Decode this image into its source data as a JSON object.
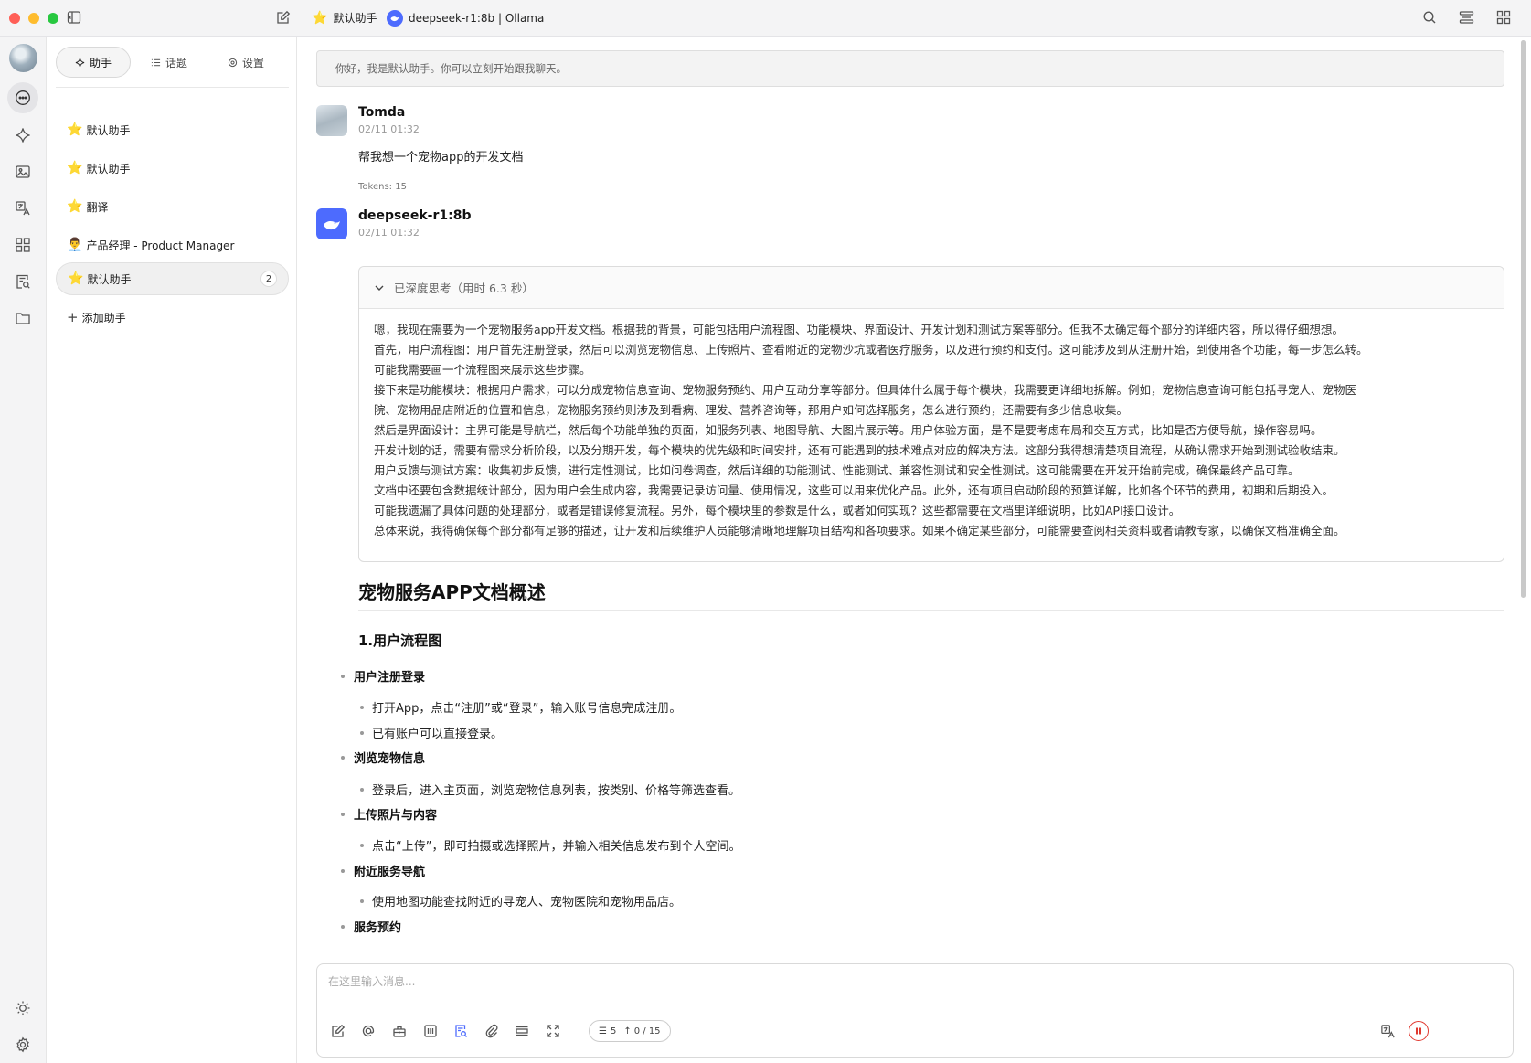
{
  "titlebar": {
    "assistant_emoji": "⭐",
    "assistant_name": "默认助手",
    "model_label": "deepseek-r1:8b | Ollama"
  },
  "sidebar": {
    "tabs": [
      {
        "label": "助手",
        "icon": "sparkle-icon"
      },
      {
        "label": "话题",
        "icon": "list-icon"
      },
      {
        "label": "设置",
        "icon": "gear-icon"
      }
    ],
    "assistants": [
      {
        "emoji": "⭐",
        "label": "默认助手"
      },
      {
        "emoji": "⭐",
        "label": "默认助手"
      },
      {
        "emoji": "⭐",
        "label": "翻译"
      },
      {
        "emoji": "👨‍💼",
        "label": "产品经理 - Product Manager"
      },
      {
        "emoji": "⭐",
        "label": "默认助手",
        "count": "2",
        "selected": true
      }
    ],
    "add_label": "添加助手"
  },
  "chat": {
    "notice": "你好，我是默认助手。你可以立刻开始跟我聊天。",
    "user_msg": {
      "name": "Tomda",
      "time": "02/11 01:32",
      "text": "帮我想一个宠物app的开发文档",
      "tokens": "Tokens: 15"
    },
    "bot_msg": {
      "name": "deepseek-r1:8b",
      "time": "02/11 01:32",
      "thinking_title": "已深度思考（用时 6.3 秒）",
      "thinking_lines": [
        "嗯，我现在需要为一个宠物服务app开发文档。根据我的背景，可能包括用户流程图、功能模块、界面设计、开发计划和测试方案等部分。但我不太确定每个部分的详细内容，所以得仔细想想。",
        "首先，用户流程图：用户首先注册登录，然后可以浏览宠物信息、上传照片、查看附近的宠物沙坑或者医疗服务，以及进行预约和支付。这可能涉及到从注册开始，到使用各个功能，每一步怎么转。",
        "可能我需要画一个流程图来展示这些步骤。",
        "接下来是功能模块：根据用户需求，可以分成宠物信息查询、宠物服务预约、用户互动分享等部分。但具体什么属于每个模块，我需要更详细地拆解。例如，宠物信息查询可能包括寻宠人、宠物医",
        "院、宠物用品店附近的位置和信息，宠物服务预约则涉及到看病、理发、营养咨询等，那用户如何选择服务，怎么进行预约，还需要有多少信息收集。",
        "然后是界面设计：主界可能是导航栏，然后每个功能单独的页面，如服务列表、地图导航、大图片展示等。用户体验方面，是不是要考虑布局和交互方式，比如是否方便导航，操作容易吗。",
        "开发计划的话，需要有需求分析阶段，以及分期开发，每个模块的优先级和时间安排，还有可能遇到的技术难点对应的解决方法。这部分我得想清楚项目流程，从确认需求开始到测试验收结束。",
        "用户反馈与测试方案：收集初步反馈，进行定性测试，比如问卷调查，然后详细的功能测试、性能测试、兼容性测试和安全性测试。这可能需要在开发开始前完成，确保最终产品可靠。",
        "文档中还要包含数据统计部分，因为用户会生成内容，我需要记录访问量、使用情况，这些可以用来优化产品。此外，还有项目启动阶段的预算详解，比如各个环节的费用，初期和后期投入。",
        "可能我遗漏了具体问题的处理部分，或者是错误修复流程。另外，每个模块里的参数是什么，或者如何实现？这些都需要在文档里详细说明，比如API接口设计。",
        "总体来说，我得确保每个部分都有足够的描述，让开发和后续维护人员能够清晰地理解项目结构和各项要求。如果不确定某些部分，可能需要查阅相关资料或者请教专家，以确保文档准确全面。"
      ],
      "answer": {
        "h2": "宠物服务APP文档概述",
        "h3": "1.用户流程图",
        "items": [
          {
            "title": "用户注册登录",
            "subs": [
              "打开App，点击“注册”或“登录”，输入账号信息完成注册。",
              "已有账户可以直接登录。"
            ]
          },
          {
            "title": "浏览宠物信息",
            "subs": [
              "登录后，进入主页面，浏览宠物信息列表，按类别、价格等筛选查看。"
            ]
          },
          {
            "title": "上传照片与内容",
            "subs": [
              "点击“上传”，即可拍摄或选择照片，并输入相关信息发布到个人空间。"
            ]
          },
          {
            "title": "附近服务导航",
            "subs": [
              "使用地图功能查找附近的寻宠人、宠物医院和宠物用品店。"
            ]
          },
          {
            "title": "服务预约",
            "subs": []
          }
        ]
      }
    }
  },
  "input": {
    "placeholder": "在这里输入消息...",
    "context_count": "5",
    "token_count": "0 / 15"
  },
  "colors": {
    "accent": "#4d6bfe",
    "stop": "#e0382f"
  }
}
